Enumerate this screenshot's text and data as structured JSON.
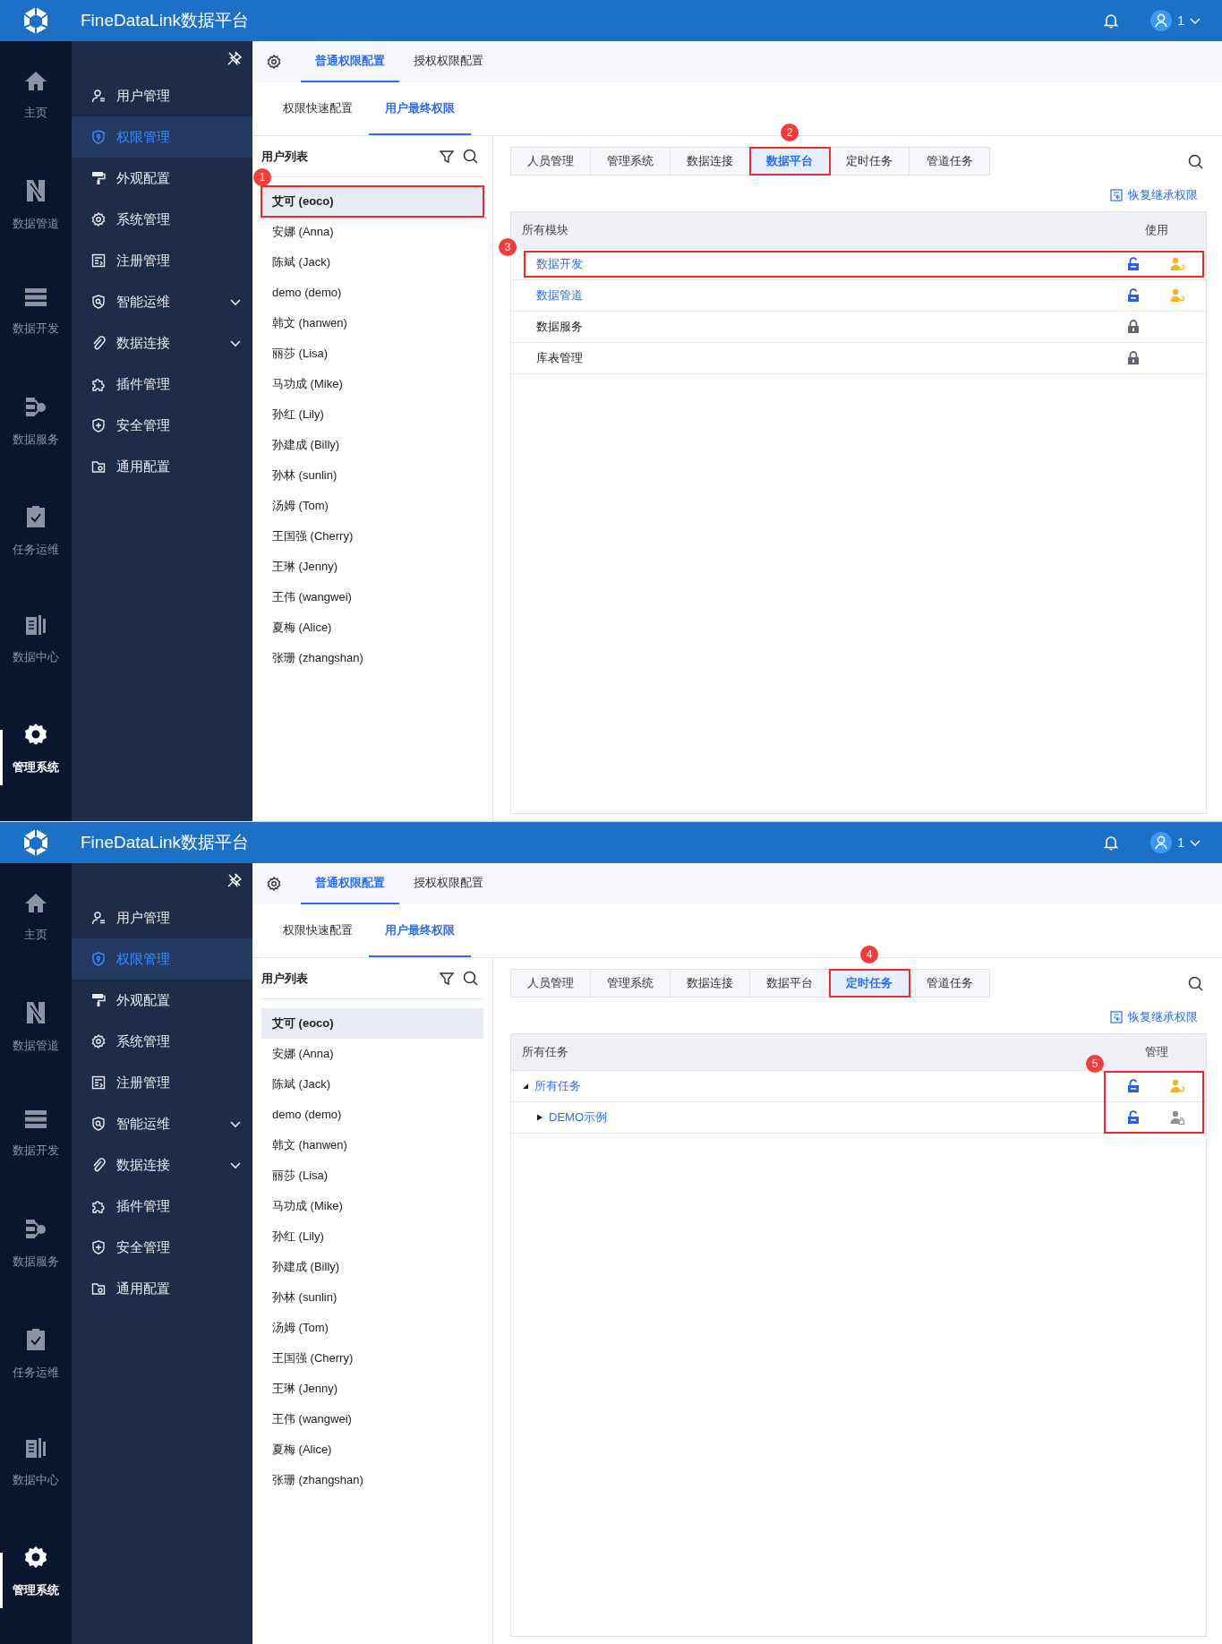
{
  "screens": [
    {
      "header": {
        "title": "FineDataLink数据平台",
        "user": "1"
      },
      "rail": [
        {
          "label": "主页",
          "selected": false
        },
        {
          "label": "数据管道",
          "selected": false
        },
        {
          "label": "数据开发",
          "selected": false
        },
        {
          "label": "数据服务",
          "selected": false
        },
        {
          "label": "任务运维",
          "selected": false
        },
        {
          "label": "数据中心",
          "selected": false
        },
        {
          "label": "管理系统",
          "selected": true
        }
      ],
      "menu": [
        {
          "label": "用户管理",
          "selected": false,
          "expandable": false
        },
        {
          "label": "权限管理",
          "selected": true,
          "expandable": false
        },
        {
          "label": "外观配置",
          "selected": false,
          "expandable": false
        },
        {
          "label": "系统管理",
          "selected": false,
          "expandable": false
        },
        {
          "label": "注册管理",
          "selected": false,
          "expandable": false
        },
        {
          "label": "智能运维",
          "selected": false,
          "expandable": true
        },
        {
          "label": "数据连接",
          "selected": false,
          "expandable": true
        },
        {
          "label": "插件管理",
          "selected": false,
          "expandable": false
        },
        {
          "label": "安全管理",
          "selected": false,
          "expandable": false
        },
        {
          "label": "通用配置",
          "selected": false,
          "expandable": false
        }
      ],
      "top_tabs": [
        {
          "label": "普通权限配置",
          "selected": true
        },
        {
          "label": "授权权限配置",
          "selected": false
        }
      ],
      "sub_tabs": [
        {
          "label": "权限快速配置",
          "selected": false
        },
        {
          "label": "用户最终权限",
          "selected": true
        }
      ],
      "user_list": {
        "title": "用户列表",
        "users": [
          {
            "name": "艾可 (eoco)",
            "selected": true,
            "marker": "1"
          },
          {
            "name": "安娜 (Anna)",
            "selected": false
          },
          {
            "name": "陈斌 (Jack)",
            "selected": false
          },
          {
            "name": "demo (demo)",
            "selected": false
          },
          {
            "name": "韩文 (hanwen)",
            "selected": false
          },
          {
            "name": "丽莎 (Lisa)",
            "selected": false
          },
          {
            "name": "马功成 (Mike)",
            "selected": false
          },
          {
            "name": "孙红 (Lily)",
            "selected": false
          },
          {
            "name": "孙建成 (Billy)",
            "selected": false
          },
          {
            "name": "孙林 (sunlin)",
            "selected": false
          },
          {
            "name": "汤姆 (Tom)",
            "selected": false
          },
          {
            "name": "王国强 (Cherry)",
            "selected": false
          },
          {
            "name": "王琳 (Jenny)",
            "selected": false
          },
          {
            "name": "王伟 (wangwei)",
            "selected": false
          },
          {
            "name": "夏梅 (Alice)",
            "selected": false
          },
          {
            "name": "张珊 (zhangshan)",
            "selected": false
          }
        ]
      },
      "category_tabs": [
        {
          "label": "人员管理",
          "selected": false
        },
        {
          "label": "管理系统",
          "selected": false
        },
        {
          "label": "数据连接",
          "selected": false
        },
        {
          "label": "数据平台",
          "selected": true,
          "marker": "2"
        },
        {
          "label": "定时任务",
          "selected": false
        },
        {
          "label": "管道任务",
          "selected": false
        }
      ],
      "restore_link": "恢复继承权限",
      "table": {
        "columns": [
          "所有模块",
          "使用"
        ],
        "rows": [
          {
            "label": "数据开发",
            "unlocked": true,
            "user_access": true,
            "marker": "3"
          },
          {
            "label": "数据管道",
            "unlocked": true,
            "user_access": true
          },
          {
            "label": "数据服务",
            "unlocked": false
          },
          {
            "label": "库表管理",
            "unlocked": false
          }
        ]
      }
    },
    {
      "header": {
        "title": "FineDataLink数据平台",
        "user": "1"
      },
      "rail": [
        {
          "label": "主页",
          "selected": false
        },
        {
          "label": "数据管道",
          "selected": false
        },
        {
          "label": "数据开发",
          "selected": false
        },
        {
          "label": "数据服务",
          "selected": false
        },
        {
          "label": "任务运维",
          "selected": false
        },
        {
          "label": "数据中心",
          "selected": false
        },
        {
          "label": "管理系统",
          "selected": true
        }
      ],
      "menu": [
        {
          "label": "用户管理",
          "selected": false,
          "expandable": false
        },
        {
          "label": "权限管理",
          "selected": true,
          "expandable": false
        },
        {
          "label": "外观配置",
          "selected": false,
          "expandable": false
        },
        {
          "label": "系统管理",
          "selected": false,
          "expandable": false
        },
        {
          "label": "注册管理",
          "selected": false,
          "expandable": false
        },
        {
          "label": "智能运维",
          "selected": false,
          "expandable": true
        },
        {
          "label": "数据连接",
          "selected": false,
          "expandable": true
        },
        {
          "label": "插件管理",
          "selected": false,
          "expandable": false
        },
        {
          "label": "安全管理",
          "selected": false,
          "expandable": false
        },
        {
          "label": "通用配置",
          "selected": false,
          "expandable": false
        }
      ],
      "top_tabs": [
        {
          "label": "普通权限配置",
          "selected": true
        },
        {
          "label": "授权权限配置",
          "selected": false
        }
      ],
      "sub_tabs": [
        {
          "label": "权限快速配置",
          "selected": false
        },
        {
          "label": "用户最终权限",
          "selected": true
        }
      ],
      "user_list": {
        "title": "用户列表",
        "users": [
          {
            "name": "艾可 (eoco)",
            "selected": true
          },
          {
            "name": "安娜 (Anna)",
            "selected": false
          },
          {
            "name": "陈斌 (Jack)",
            "selected": false
          },
          {
            "name": "demo (demo)",
            "selected": false
          },
          {
            "name": "韩文 (hanwen)",
            "selected": false
          },
          {
            "name": "丽莎 (Lisa)",
            "selected": false
          },
          {
            "name": "马功成 (Mike)",
            "selected": false
          },
          {
            "name": "孙红 (Lily)",
            "selected": false
          },
          {
            "name": "孙建成 (Billy)",
            "selected": false
          },
          {
            "name": "孙林 (sunlin)",
            "selected": false
          },
          {
            "name": "汤姆 (Tom)",
            "selected": false
          },
          {
            "name": "王国强 (Cherry)",
            "selected": false
          },
          {
            "name": "王琳 (Jenny)",
            "selected": false
          },
          {
            "name": "王伟 (wangwei)",
            "selected": false
          },
          {
            "name": "夏梅 (Alice)",
            "selected": false
          },
          {
            "name": "张珊 (zhangshan)",
            "selected": false
          }
        ]
      },
      "category_tabs": [
        {
          "label": "人员管理",
          "selected": false
        },
        {
          "label": "管理系统",
          "selected": false
        },
        {
          "label": "数据连接",
          "selected": false
        },
        {
          "label": "数据平台",
          "selected": false
        },
        {
          "label": "定时任务",
          "selected": true,
          "marker": "4"
        },
        {
          "label": "管道任务",
          "selected": false
        }
      ],
      "restore_link": "恢复继承权限",
      "table": {
        "columns": [
          "所有任务",
          "管理"
        ],
        "icons_marker": "5",
        "rows": [
          {
            "label": "所有任务",
            "unlocked": true,
            "user_access": true,
            "expanded": true,
            "children": [
              {
                "label": "DEMO示例",
                "unlocked": true,
                "user_access": false,
                "expanded": false
              }
            ]
          }
        ]
      }
    }
  ]
}
